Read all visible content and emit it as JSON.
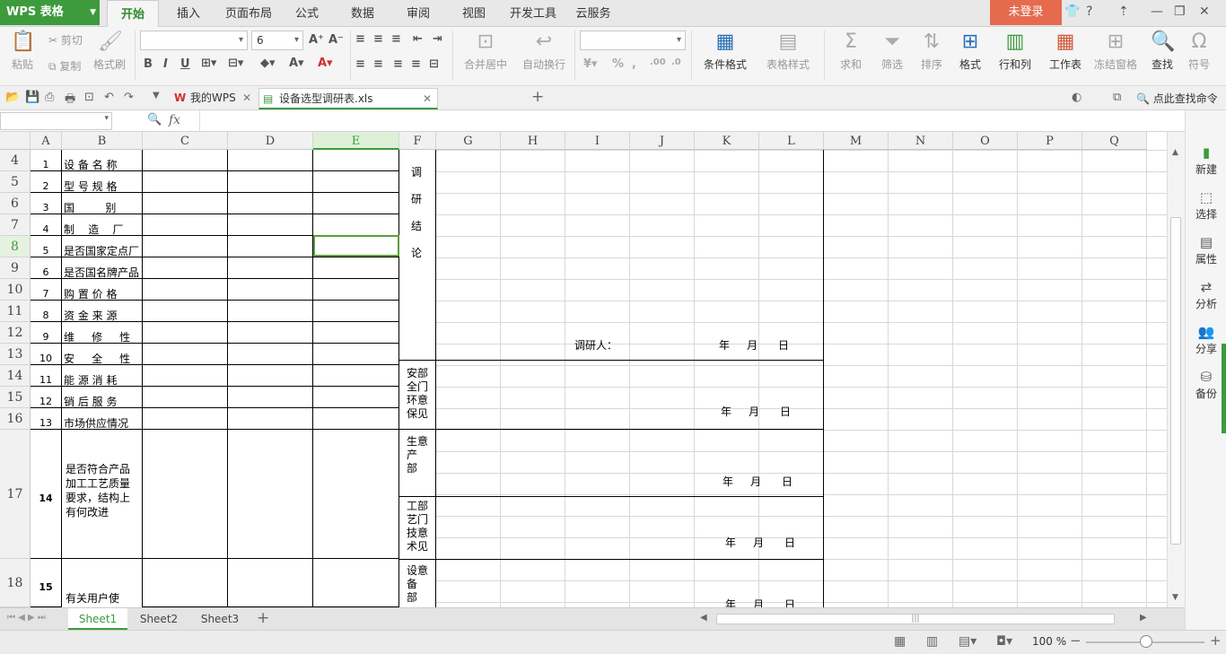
{
  "app": {
    "logo": "WPS 表格",
    "login": "未登录"
  },
  "menu_tabs": [
    "开始",
    "插入",
    "页面布局",
    "公式",
    "数据",
    "审阅",
    "视图",
    "开发工具",
    "云服务"
  ],
  "ribbon": {
    "paste": "粘贴",
    "cut": "剪切",
    "copy": "复制",
    "format_painter": "格式刷",
    "font_name": "",
    "font_size": "6",
    "merge_center": "合并居中",
    "wrap": "自动换行",
    "number_format": "",
    "cond_format": "条件格式",
    "table_style": "表格样式",
    "sum": "求和",
    "filter": "筛选",
    "sort": "排序",
    "format": "格式",
    "rows_cols": "行和列",
    "worksheet": "工作表",
    "freeze": "冻结窗格",
    "find": "查找",
    "symbol": "符号"
  },
  "doc_tabs": {
    "home": "我的WPS",
    "file": "设备选型调研表.xls",
    "search": "点此查找命令"
  },
  "formula": {
    "name_box": "",
    "fx": "fx",
    "value": ""
  },
  "columns": [
    "A",
    "B",
    "C",
    "D",
    "E",
    "F",
    "G",
    "H",
    "I",
    "J",
    "K",
    "L",
    "M",
    "N",
    "O",
    "P",
    "Q"
  ],
  "rows": [
    {
      "hdr": "4",
      "no": "1",
      "item": "设 备 名 称"
    },
    {
      "hdr": "5",
      "no": "2",
      "item": "型 号 规 格"
    },
    {
      "hdr": "6",
      "no": "3",
      "item": "国         别"
    },
    {
      "hdr": "7",
      "no": "4",
      "item": "制    造    厂"
    },
    {
      "hdr": "8",
      "no": "5",
      "item": "是否国家定点厂"
    },
    {
      "hdr": "9",
      "no": "6",
      "item": "是否国名牌产品"
    },
    {
      "hdr": "10",
      "no": "7",
      "item": "购 置 价 格"
    },
    {
      "hdr": "11",
      "no": "8",
      "item": "资 金 来 源"
    },
    {
      "hdr": "12",
      "no": "9",
      "item": "维     修     性"
    },
    {
      "hdr": "13",
      "no": "10",
      "item": "安     全     性"
    },
    {
      "hdr": "14",
      "no": "11",
      "item": "能 源 消 耗"
    },
    {
      "hdr": "15",
      "no": "12",
      "item": "销 后 服 务"
    },
    {
      "hdr": "16",
      "no": "13",
      "item": "市场供应情况"
    },
    {
      "hdr": "17",
      "no": "14",
      "item": "是否符合产品\n加工工艺质量\n要求，结构上\n有何改进"
    },
    {
      "hdr": "18",
      "no": "15",
      "item": "有关用户使\n\n用情况调查"
    }
  ],
  "f_labels": {
    "conclusion": "调\n\n研\n\n结\n\n论",
    "safety": "安部\n全门\n环意\n保见",
    "production": "生意\n产\n部",
    "tech": "工部\n艺门\n技意\n术见",
    "equipment": "设意\n备\n部"
  },
  "researcher": "调研人：",
  "date": "年     月      日",
  "sheets": [
    "Sheet1",
    "Sheet2",
    "Sheet3"
  ],
  "status": {
    "zoom": "100 %"
  },
  "right_panel": [
    "新建",
    "选择",
    "属性",
    "分析",
    "分享",
    "备份"
  ]
}
